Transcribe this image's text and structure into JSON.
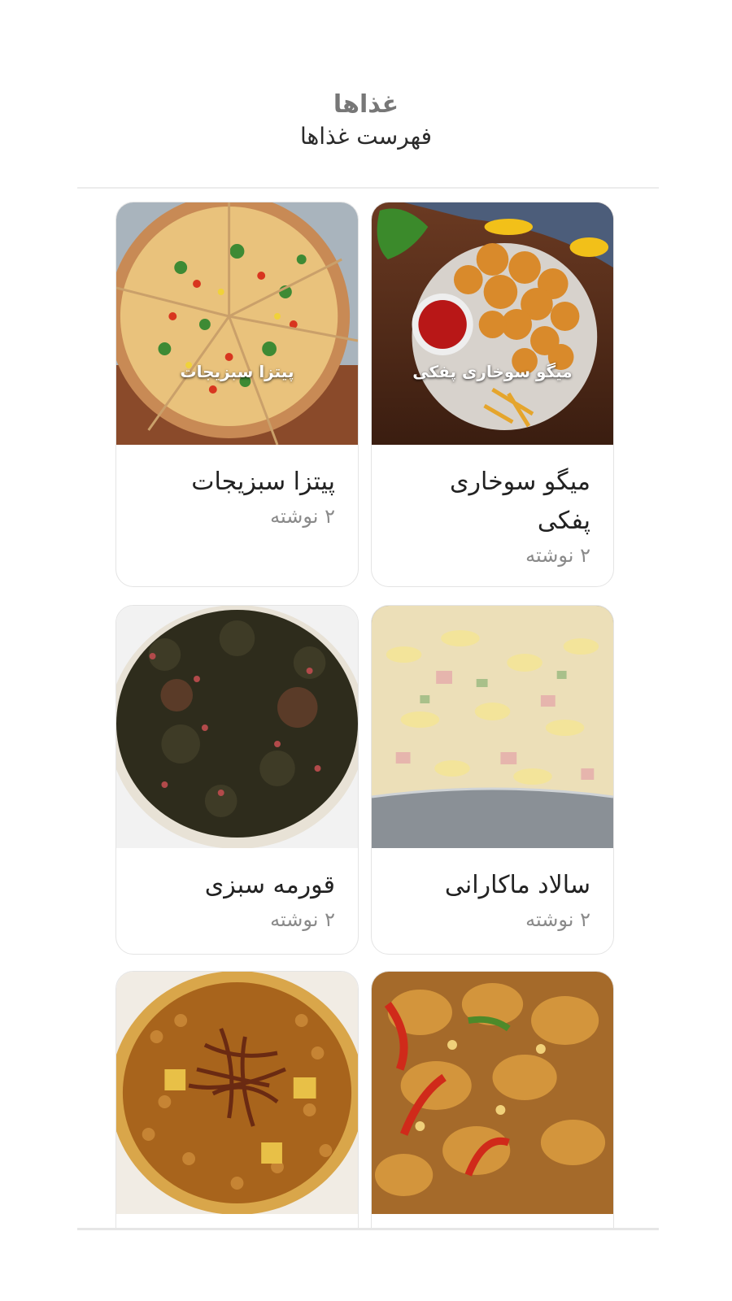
{
  "header": {
    "title": "غذاها",
    "subtitle": "فهرست غذاها"
  },
  "foods": [
    {
      "title": "میگو سوخاری پفکی",
      "meta": "۲ نوشته",
      "image_caption": "میگو سوخاری پفکی",
      "image": "fried-shrimp-image"
    },
    {
      "title": "پیتزا سبزیجات",
      "meta": "۲ نوشته",
      "image_caption": "پیتزا سبزیجات",
      "image": "vegetable-pizza-image"
    },
    {
      "title": "سالاد ماکارانی",
      "meta": "۲ نوشته",
      "image": "macaroni-salad-image"
    },
    {
      "title": "قورمه سبزی",
      "meta": "۲ نوشته",
      "image": "ghormeh-sabzi-image"
    },
    {
      "image": "roast-chicken-image"
    },
    {
      "image": "lentil-stew-image"
    }
  ]
}
